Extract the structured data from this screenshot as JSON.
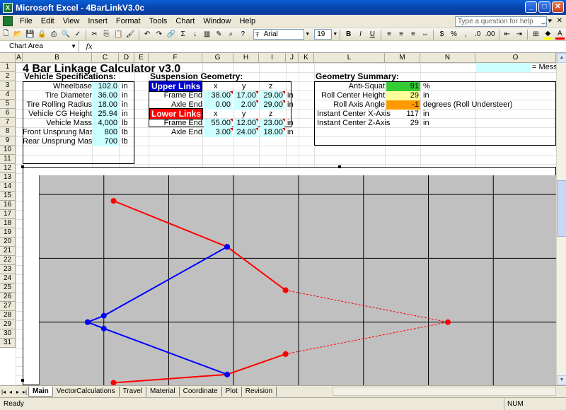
{
  "window": {
    "title": "Microsoft Excel - 4BarLinkV3.0c"
  },
  "menu": [
    "File",
    "Edit",
    "View",
    "Insert",
    "Format",
    "Tools",
    "Chart",
    "Window",
    "Help"
  ],
  "help_placeholder": "Type a question for help",
  "toolbar": {
    "font": "Arial",
    "size": "19"
  },
  "namebox": "Chart Area",
  "fx": "fx",
  "columns": [
    "A",
    "B",
    "C",
    "D",
    "E",
    "F",
    "G",
    "H",
    "I",
    "J",
    "K",
    "L",
    "M",
    "N",
    "O"
  ],
  "rows": [
    "1",
    "2",
    "3",
    "4",
    "5",
    "6",
    "7",
    "8",
    "9",
    "10",
    "11",
    "12",
    "13",
    "14",
    "15",
    "16",
    "17",
    "18",
    "19",
    "20",
    "21",
    "22",
    "23",
    "24",
    "25",
    "26",
    "27",
    "28",
    "29",
    "30",
    "31"
  ],
  "title": "4 Bar Linkage Calculator v3.0",
  "message_legend": "= Mess",
  "vehicle": {
    "header": "Vehicle Specifications:",
    "rows": [
      {
        "label": "Wheelbase",
        "value": "102.0",
        "unit": "in"
      },
      {
        "label": "Tire Diameter",
        "value": "36.00",
        "unit": "in"
      },
      {
        "label": "Tire Rolling Radius",
        "value": "18.00",
        "unit": "in"
      },
      {
        "label": "Vehicle CG Height",
        "value": "25.94",
        "unit": "in"
      },
      {
        "label": "Vehicle Mass",
        "value": "4,000",
        "unit": "lb"
      },
      {
        "label": "Front Unsprung Mass",
        "value": "800",
        "unit": "lb"
      },
      {
        "label": "Rear Unsprung Mass",
        "value": "700",
        "unit": "lb"
      }
    ]
  },
  "suspension": {
    "header": "Suspension Geometry:",
    "upper_label": "Upper Links",
    "lower_label": "Lower Links",
    "axes": [
      "x",
      "y",
      "z"
    ],
    "upper": [
      {
        "label": "Frame End",
        "x": "38.00",
        "y": "17.00",
        "z": "29.00",
        "unit": "in"
      },
      {
        "label": "Axle End",
        "x": "0.00",
        "y": "2.00",
        "z": "29.00",
        "unit": "in"
      }
    ],
    "lower": [
      {
        "label": "Frame End",
        "x": "55.00",
        "y": "12.00",
        "z": "23.00",
        "unit": "in"
      },
      {
        "label": "Axle End",
        "x": "3.00",
        "y": "24.00",
        "z": "18.00",
        "unit": "in"
      }
    ]
  },
  "summary": {
    "header": "Geometry Summary:",
    "rows": [
      {
        "label": "Anti-Squat",
        "value": "91",
        "unit": "%",
        "color": "#33cc33"
      },
      {
        "label": "Roll Center Height",
        "value": "29",
        "unit": "in",
        "color": "#ffff99"
      },
      {
        "label": "Roll Axis Angle",
        "value": "-1",
        "unit": "degrees (Roll Understeer)",
        "color": "#ff9900"
      },
      {
        "label": "Instant Center X-Axis",
        "value": "117",
        "unit": "in",
        "color": "#ffffff"
      },
      {
        "label": "Instant Center Z-Axis",
        "value": "29",
        "unit": "in",
        "color": "#ffffff"
      }
    ]
  },
  "chart_data": {
    "type": "line",
    "xlim": [
      0,
      8
    ],
    "ylim": [
      0,
      3.3
    ],
    "grid": true,
    "series": [
      {
        "color": "#ff0000",
        "style": "solid",
        "points": [
          [
            1.15,
            2.9
          ],
          [
            2.9,
            2.18
          ],
          [
            3.8,
            1.5
          ]
        ]
      },
      {
        "color": "#ff0000",
        "style": "dashed",
        "points": [
          [
            3.8,
            1.5
          ],
          [
            6.3,
            1.0
          ],
          [
            3.8,
            0.5
          ]
        ]
      },
      {
        "color": "#ff0000",
        "style": "solid",
        "points": [
          [
            3.8,
            0.5
          ],
          [
            2.9,
            0.18
          ],
          [
            1.15,
            0.05
          ]
        ]
      },
      {
        "color": "#0000ff",
        "style": "solid",
        "points": [
          [
            0.75,
            1.0
          ],
          [
            1.0,
            1.1
          ],
          [
            2.9,
            2.18
          ]
        ]
      },
      {
        "color": "#0000ff",
        "style": "solid",
        "points": [
          [
            0.75,
            1.0
          ],
          [
            1.0,
            0.9
          ],
          [
            2.9,
            0.18
          ]
        ]
      }
    ]
  },
  "sheets": [
    "Main",
    "VectorCalculations",
    "Travel",
    "Material",
    "Coordinate",
    "Plot",
    "Revision"
  ],
  "active_sheet": "Main",
  "status": {
    "left": "Ready",
    "num": "NUM"
  }
}
